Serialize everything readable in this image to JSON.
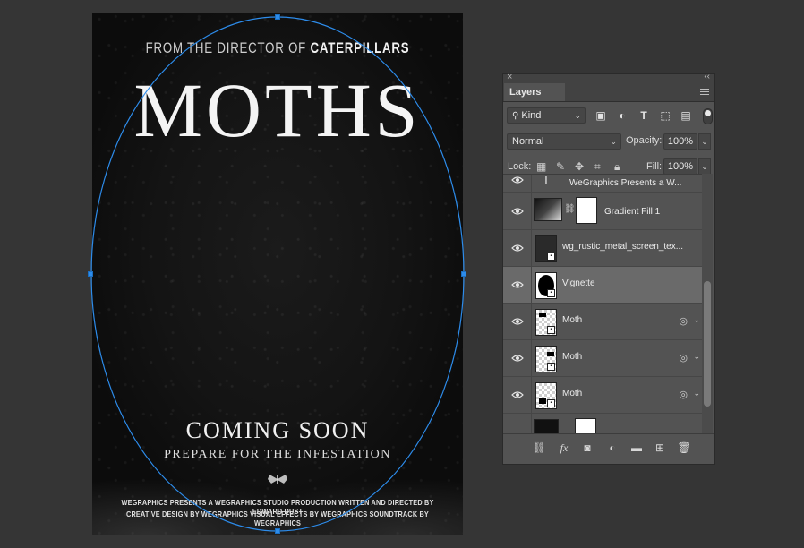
{
  "poster": {
    "tagline_prefix": "FROM THE DIRECTOR OF",
    "tagline_film": "CATERPILLARS",
    "title": "MOTHS",
    "coming": "COMING SOON",
    "prepare": "PREPARE FOR THE INFESTATION",
    "credits_line1": "WEGRAPHICS PRESENTS A WEGRAPHICS STUDIO PRODUCTION WRITTEN AND DIRECTED BY EDWARD DUST",
    "credits_line2": "CREATIVE DESIGN BY WEGRAPHICS VISUAL EFFECTS BY WEGRAPHICS SOUNDTRACK BY WEGRAPHICS"
  },
  "panel": {
    "tab": "Layers",
    "filter_kind": "Kind",
    "blend_mode": "Normal",
    "opacity_label": "Opacity:",
    "opacity_value": "100%",
    "lock_label": "Lock:",
    "fill_label": "Fill:",
    "fill_value": "100%"
  },
  "layers": [
    {
      "name": "WeGraphics Presents a W...",
      "type": "text"
    },
    {
      "name": "Gradient Fill 1",
      "type": "gradient"
    },
    {
      "name": "wg_rustic_metal_screen_tex...",
      "type": "smart"
    },
    {
      "name": "Vignette",
      "type": "vignette",
      "selected": true
    },
    {
      "name": "Moth",
      "type": "moth"
    },
    {
      "name": "Moth",
      "type": "moth"
    },
    {
      "name": "Moth",
      "type": "moth"
    }
  ],
  "colors": {
    "selection_path": "#2d8ceb",
    "panel_bg": "#535353",
    "selected_row": "#6a6a6a"
  }
}
